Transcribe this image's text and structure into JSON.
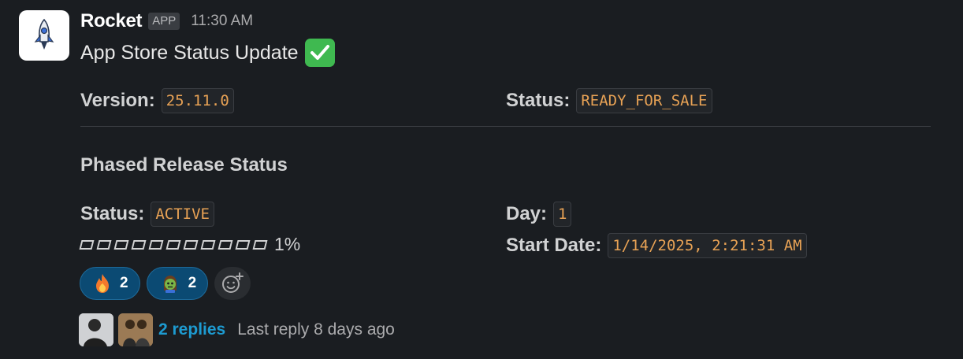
{
  "sender": {
    "name": "Rocket",
    "badge": "APP",
    "time": "11:30 AM",
    "avatar_icon": "rocket-icon"
  },
  "message": {
    "title": "App Store Status Update",
    "title_icon": "check-mark-icon"
  },
  "fields": {
    "version": {
      "label": "Version:",
      "value": "25.11.0"
    },
    "status": {
      "label": "Status:",
      "value": "READY_FOR_SALE"
    }
  },
  "phased": {
    "title": "Phased Release Status",
    "status": {
      "label": "Status:",
      "value": "ACTIVE"
    },
    "day": {
      "label": "Day:",
      "value": "1"
    },
    "start_date": {
      "label": "Start Date:",
      "value": "1/14/2025, 2:21:31 AM"
    },
    "progress": {
      "boxes": 11,
      "percent_label": "1%",
      "fraction": 0.01
    }
  },
  "reactions": [
    {
      "emoji": "fire-icon",
      "count": "2"
    },
    {
      "emoji": "zombie-icon",
      "count": "2"
    }
  ],
  "thread": {
    "replies": "2 replies",
    "last_reply": "Last reply 8 days ago"
  },
  "colors": {
    "background": "#1a1d21",
    "code": "#e8a255",
    "link": "#1d9bd1",
    "reaction_bg": "#0b4a73"
  }
}
